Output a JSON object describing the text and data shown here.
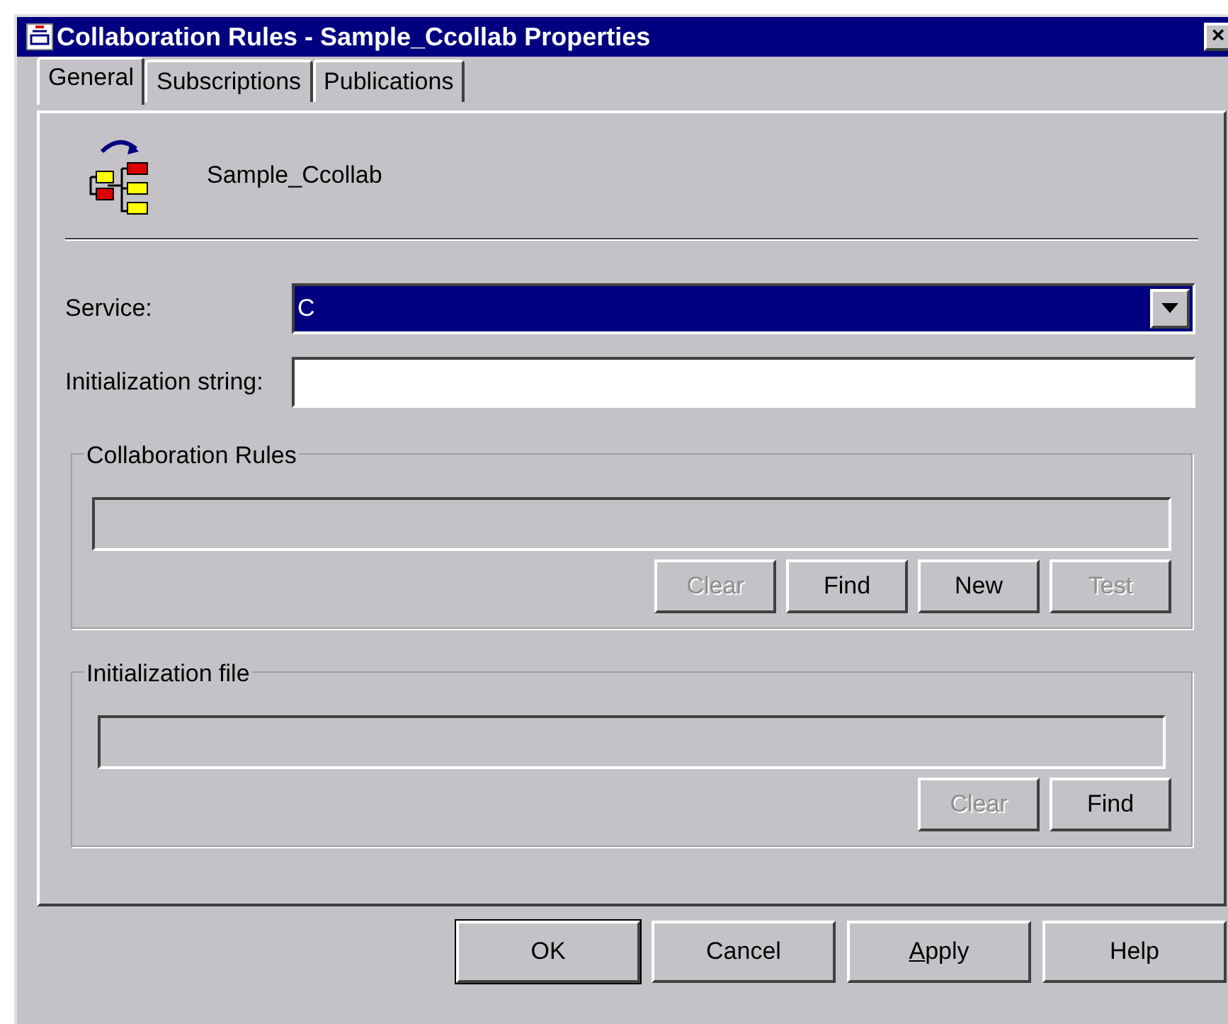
{
  "window": {
    "title": "Collaboration Rules - Sample_Ccollab Properties",
    "close": "×"
  },
  "tabs": [
    {
      "label": "General",
      "selected": true
    },
    {
      "label": "Subscriptions",
      "selected": false
    },
    {
      "label": "Publications",
      "selected": false
    }
  ],
  "header": {
    "name": "Sample_Ccollab"
  },
  "service": {
    "label": "Service:",
    "value": "C"
  },
  "initialization_string": {
    "label": "Initialization string:"
  },
  "collaboration_rules": {
    "title": "Collaboration Rules",
    "buttons": [
      {
        "label": "Clear",
        "disabled": true
      },
      {
        "label": "Find",
        "disabled": false
      },
      {
        "label": "New",
        "disabled": false
      },
      {
        "label": "Test",
        "disabled": true
      }
    ]
  },
  "initialization_file": {
    "title": "Initialization file",
    "buttons": [
      {
        "label": "Clear",
        "disabled": true
      },
      {
        "label": "Find",
        "disabled": false
      }
    ]
  },
  "buttons": [
    {
      "label": "OK",
      "default": true,
      "mnemonic": false
    },
    {
      "label": "Cancel",
      "default": false,
      "mnemonic": false
    },
    {
      "label": "Apply",
      "default": false,
      "mnemonic": true
    },
    {
      "label": "Help",
      "default": false,
      "mnemonic": false
    }
  ]
}
